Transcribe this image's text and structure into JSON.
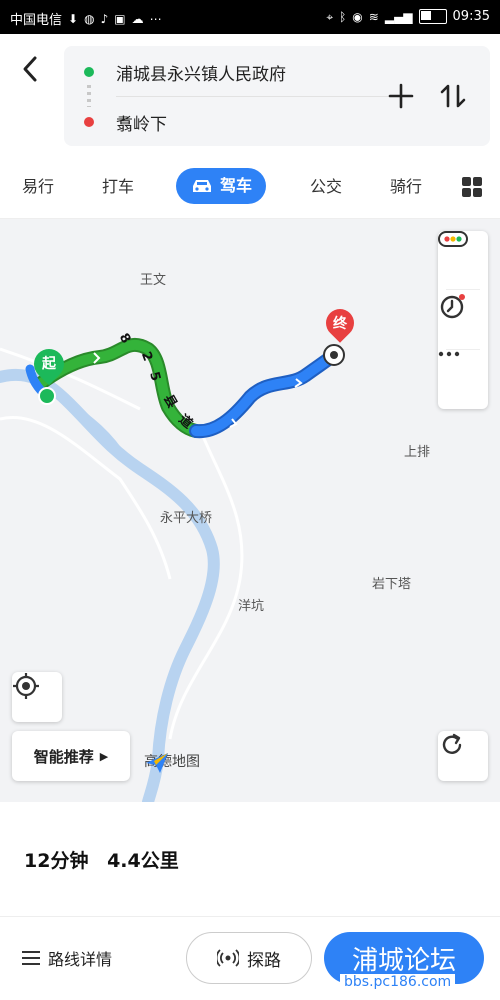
{
  "status_bar": {
    "carrier": "中国电信",
    "time": "09:35"
  },
  "route": {
    "origin": "浦城县永兴镇人民政府",
    "destination": "翥岭下"
  },
  "tabs": [
    {
      "label": "易行"
    },
    {
      "label": "打车"
    },
    {
      "label": "驾车"
    },
    {
      "label": "公交"
    },
    {
      "label": "骑行"
    }
  ],
  "map": {
    "places": [
      "王文",
      "永平大桥",
      "洋坑",
      "上排",
      "岩下塔"
    ],
    "start_marker": "起",
    "end_marker": "终",
    "road_label": [
      "8",
      "2",
      "5",
      "县",
      "道"
    ],
    "smart_recommend": "智能推荐",
    "logo_text": "高德地图"
  },
  "summary": {
    "duration": "12分钟",
    "distance": "4.4公里"
  },
  "actions": {
    "details": "路线详情",
    "explore": "探路",
    "start": "浦城论坛",
    "watermark": "bbs.pc186.com"
  },
  "colors": {
    "accent": "#2e82f6",
    "route_green": "#34b33a",
    "route_blue": "#2e82f6",
    "river": "#b8d3f0"
  }
}
